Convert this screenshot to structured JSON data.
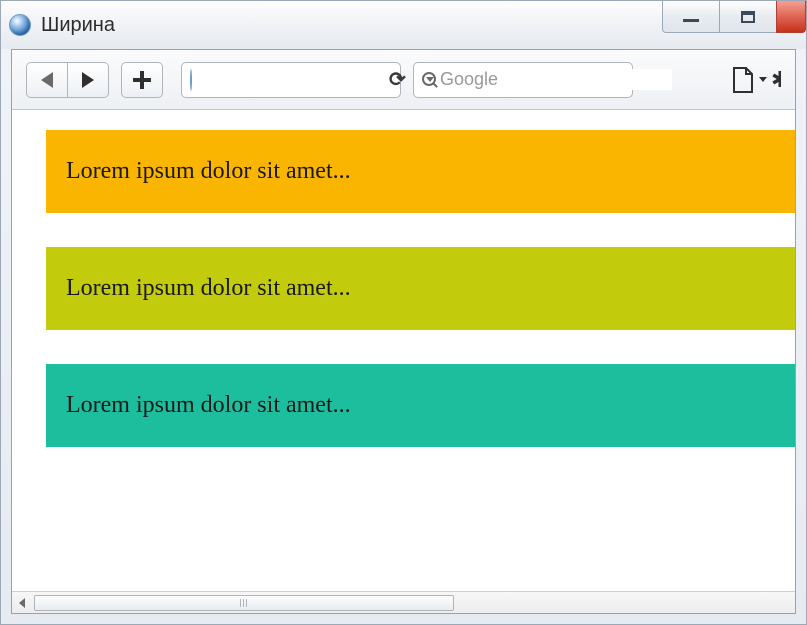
{
  "window": {
    "title": "Ширина"
  },
  "toolbar": {
    "search_placeholder": "Google",
    "url_value": ""
  },
  "blocks": [
    {
      "text": "Lorem ipsum dolor sit amet...",
      "color": "#f9b500"
    },
    {
      "text": "Lorem ipsum dolor sit amet...",
      "color": "#c2cb0c"
    },
    {
      "text": "Lorem ipsum dolor sit amet...",
      "color": "#1dbe9e"
    }
  ]
}
